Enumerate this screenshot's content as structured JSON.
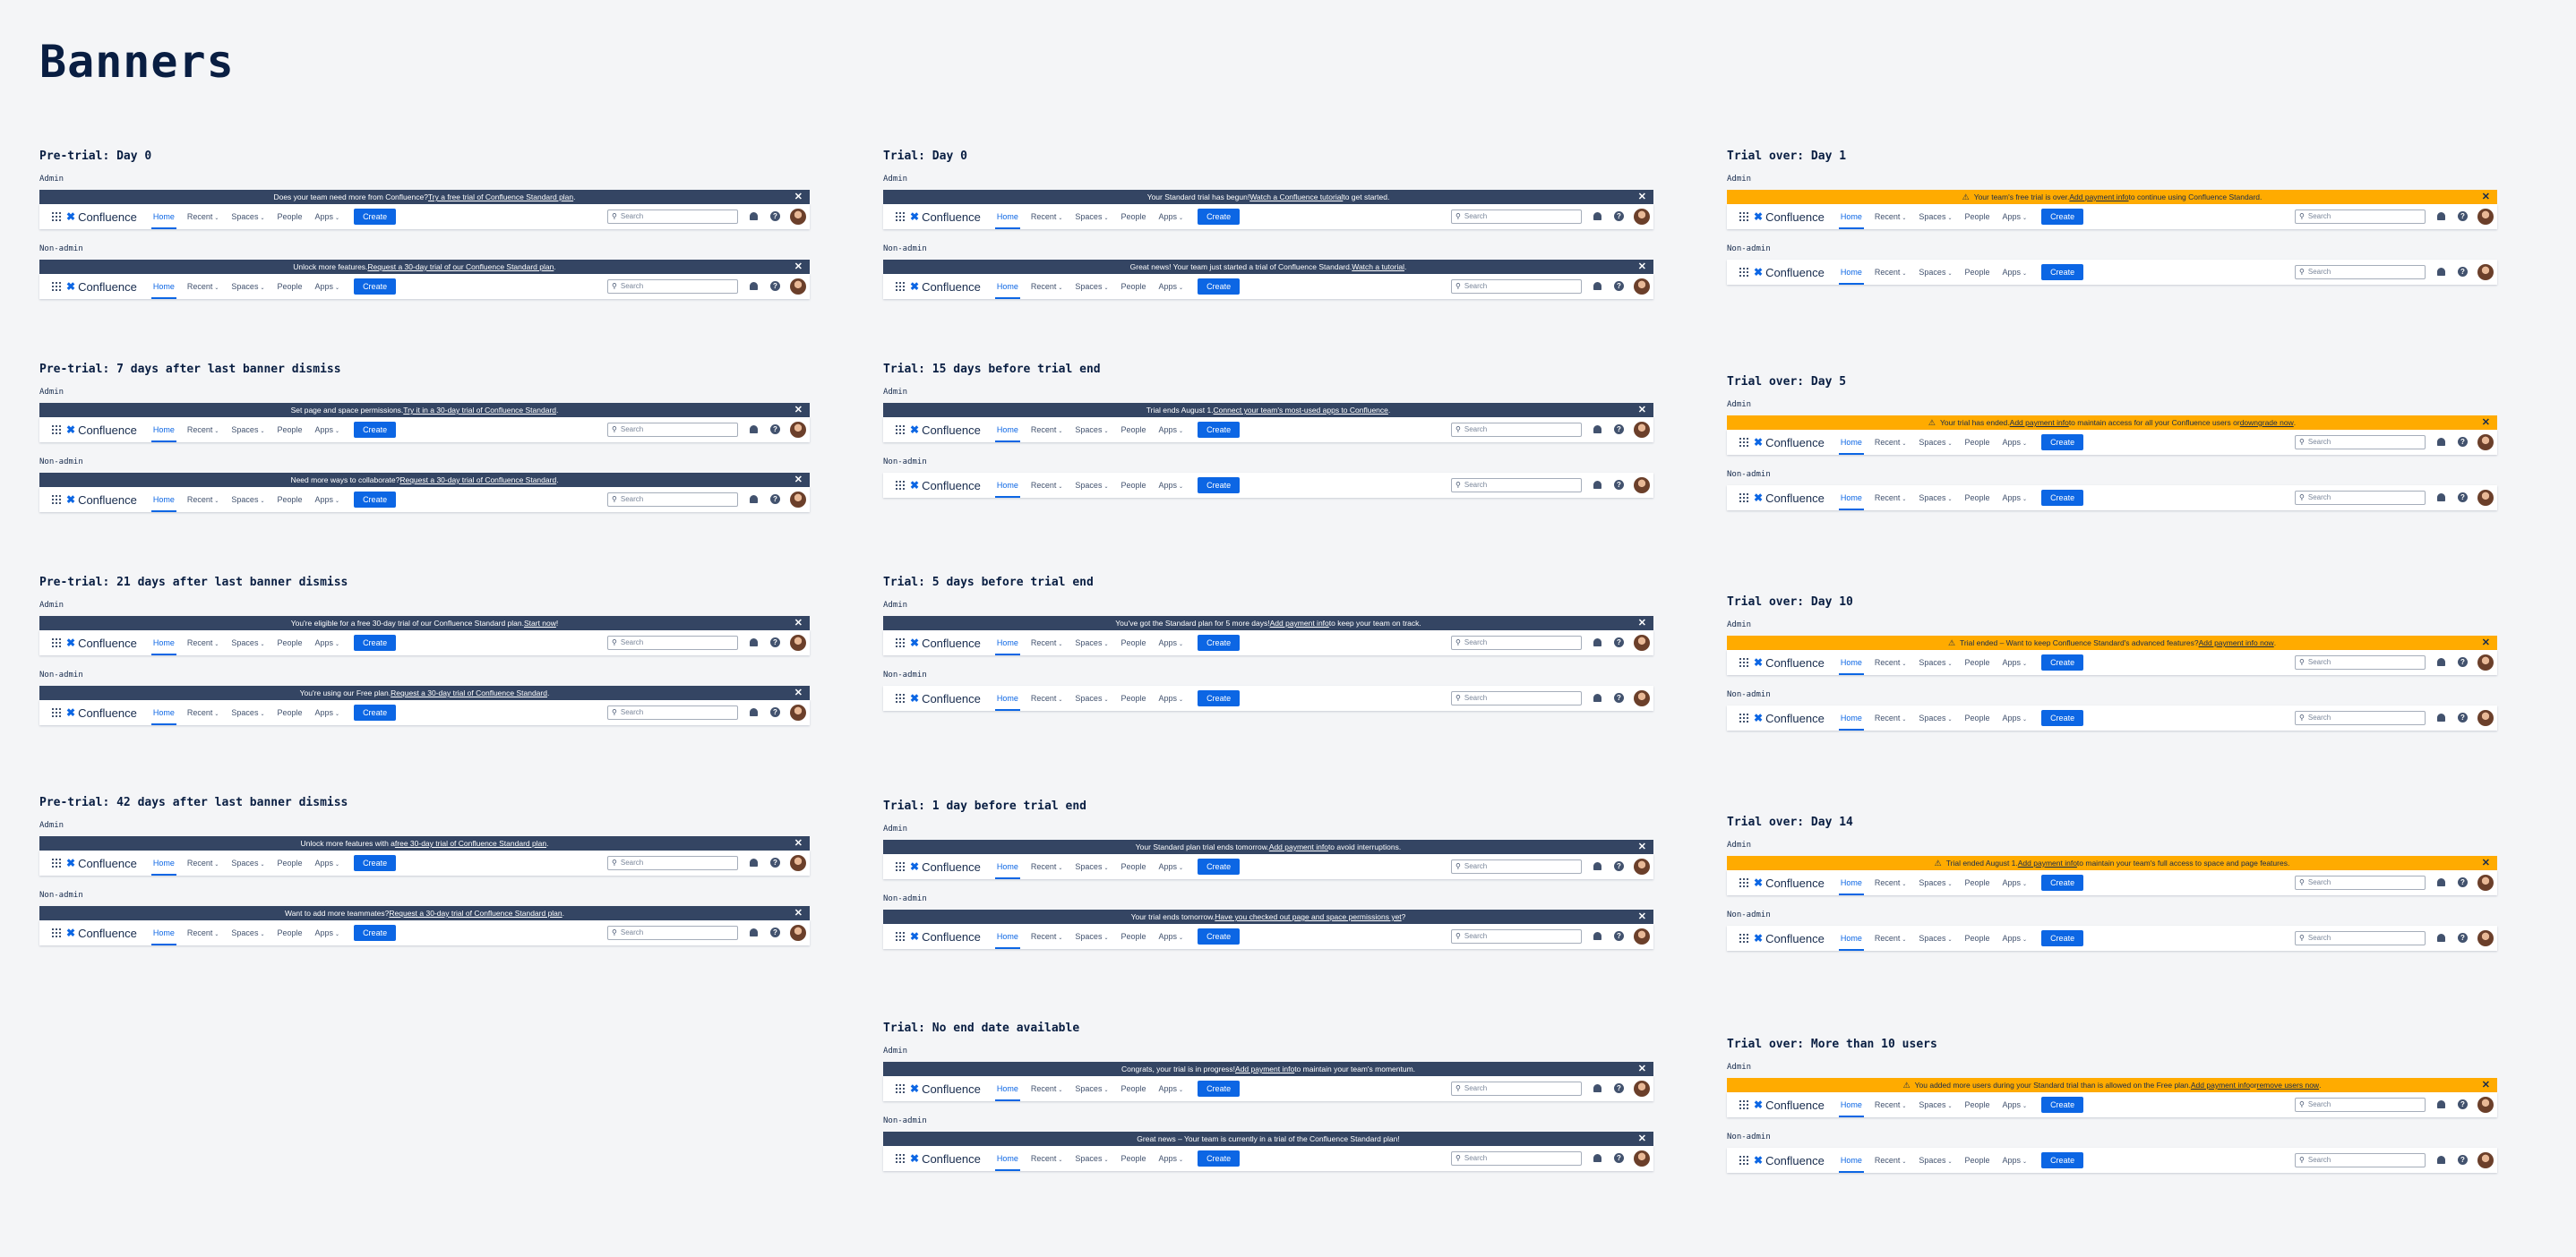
{
  "page_title": "Banners",
  "nav": {
    "logo": "Confluence",
    "home": "Home",
    "recent": "Recent",
    "spaces": "Spaces",
    "people": "People",
    "apps": "Apps",
    "create": "Create",
    "search_placeholder": "Search",
    "help": "?",
    "chevron": "⌄",
    "close": "✕",
    "warning": "⚠"
  },
  "labels": {
    "admin": "Admin",
    "non_admin": "Non-admin"
  },
  "colors": {
    "navy_banner": "#344563",
    "amber_banner": "#ffab00",
    "brand_blue": "#0c66e4",
    "page_bg": "#f4f5f7"
  },
  "columns": [
    {
      "sections": [
        {
          "title": "Pre-trial: Day 0",
          "units": [
            {
              "label": "Admin",
              "banner": {
                "style": "navy",
                "pre": "Does your team need more from Confluence? ",
                "link": "Try a free trial of Confluence Standard plan",
                "post": "."
              }
            },
            {
              "label": "Non-admin",
              "banner": {
                "style": "navy",
                "pre": "Unlock more features. ",
                "link": "Request a 30-day trial of our Confluence Standard plan",
                "post": "."
              }
            }
          ]
        },
        {
          "title": "Pre-trial: 7 days after last banner dismiss",
          "units": [
            {
              "label": "Admin",
              "banner": {
                "style": "navy",
                "pre": "Set page and space permissions. ",
                "link": "Try it in a 30-day trial of Confluence Standard",
                "post": "."
              }
            },
            {
              "label": "Non-admin",
              "banner": {
                "style": "navy",
                "pre": "Need more ways to collaborate? ",
                "link": "Request a 30-day trial of Confluence Standard",
                "post": "."
              }
            }
          ]
        },
        {
          "title": "Pre-trial: 21 days after last banner dismiss",
          "units": [
            {
              "label": "Admin",
              "banner": {
                "style": "navy",
                "pre": "You're eligible for a free 30-day trial of our Confluence Standard plan. ",
                "link": "Start now",
                "post": "!"
              }
            },
            {
              "label": "Non-admin",
              "banner": {
                "style": "navy",
                "pre": "You're using our Free plan. ",
                "link": "Request a 30-day trial of Confluence Standard",
                "post": "."
              }
            }
          ]
        },
        {
          "title": "Pre-trial: 42 days after last banner dismiss",
          "units": [
            {
              "label": "Admin",
              "banner": {
                "style": "navy",
                "pre": "Unlock more features with a ",
                "link": "free 30-day trial of Confluence Standard plan",
                "post": "."
              }
            },
            {
              "label": "Non-admin",
              "banner": {
                "style": "navy",
                "pre": "Want to add more teammates? ",
                "link": "Request a 30-day trial of Confluence Standard plan",
                "post": "."
              }
            }
          ]
        }
      ]
    },
    {
      "sections": [
        {
          "title": "Trial: Day 0",
          "units": [
            {
              "label": "Admin",
              "banner": {
                "style": "navy",
                "pre": "Your Standard trial has begun! ",
                "link": "Watch a Confluence tutorial",
                "post": " to get started."
              }
            },
            {
              "label": "Non-admin",
              "banner": {
                "style": "navy",
                "pre": "Great news! Your team just started a trial of Confluence Standard. ",
                "link": "Watch a tutorial",
                "post": "."
              }
            }
          ]
        },
        {
          "title": "Trial: 15 days before trial end",
          "units": [
            {
              "label": "Admin",
              "banner": {
                "style": "navy",
                "pre": "Trial ends August 1. ",
                "link": "Connect your team's most-used apps to Confluence",
                "post": "."
              }
            },
            {
              "label": "Non-admin"
            }
          ]
        },
        {
          "title": "Trial: 5 days before trial end",
          "units": [
            {
              "label": "Admin",
              "banner": {
                "style": "navy",
                "pre": "You've got the Standard plan for 5 more days! ",
                "link": "Add payment info",
                "post": " to keep your team on track."
              }
            },
            {
              "label": "Non-admin"
            }
          ]
        },
        {
          "title": "Trial: 1 day before trial end",
          "units": [
            {
              "label": "Admin",
              "banner": {
                "style": "navy",
                "pre": "Your Standard plan trial ends tomorrow. ",
                "link": "Add payment info",
                "post": " to avoid interruptions."
              }
            },
            {
              "label": "Non-admin",
              "banner": {
                "style": "navy",
                "pre": "Your trial ends tomorrow. ",
                "link": "Have you checked out page and space permissions yet",
                "post": "?"
              }
            }
          ]
        },
        {
          "title": "Trial: No end date available",
          "units": [
            {
              "label": "Admin",
              "banner": {
                "style": "navy",
                "pre": "Congrats, your trial is in progress! ",
                "link": "Add payment info",
                "post": " to maintain your team's momentum."
              }
            },
            {
              "label": "Non-admin",
              "banner": {
                "style": "navy",
                "pre": "Great news – Your team is currently in a trial of the Confluence Standard plan!",
                "link": "",
                "post": ""
              }
            }
          ]
        }
      ]
    },
    {
      "sections": [
        {
          "title": "Trial over: Day 1",
          "units": [
            {
              "label": "Admin",
              "banner": {
                "style": "amber",
                "pre": "Your team's free trial is over. ",
                "link": "Add payment info",
                "post": " to continue using Confluence Standard."
              }
            },
            {
              "label": "Non-admin"
            }
          ]
        },
        {
          "title": "Trial over: Day 5",
          "units": [
            {
              "label": "Admin",
              "banner": {
                "style": "amber",
                "pre": "Your trial has ended. ",
                "link": "Add payment info",
                "post": " to maintain access for all your Confluence users or ",
                "link2": "downgrade now",
                "post2": "."
              }
            },
            {
              "label": "Non-admin"
            }
          ]
        },
        {
          "title": "Trial over: Day 10",
          "units": [
            {
              "label": "Admin",
              "banner": {
                "style": "amber",
                "pre": "Trial ended – Want to keep Confluence Standard's advanced features? ",
                "link": "Add payment info now",
                "post": "."
              }
            },
            {
              "label": "Non-admin"
            }
          ]
        },
        {
          "title": "Trial over: Day 14",
          "units": [
            {
              "label": "Admin",
              "banner": {
                "style": "amber",
                "pre": "Trial ended August 1. ",
                "link": "Add payment info",
                "post": " to maintain your team's full access to space and page features."
              }
            },
            {
              "label": "Non-admin"
            }
          ]
        },
        {
          "title": "Trial over: More than 10 users",
          "units": [
            {
              "label": "Admin",
              "banner": {
                "style": "amber",
                "pre": "You added more users during your Standard trial than is allowed on the Free plan. ",
                "link": "Add payment info",
                "post": " or ",
                "link2": "remove users now",
                "post2": "."
              }
            },
            {
              "label": "Non-admin"
            }
          ]
        }
      ]
    }
  ]
}
